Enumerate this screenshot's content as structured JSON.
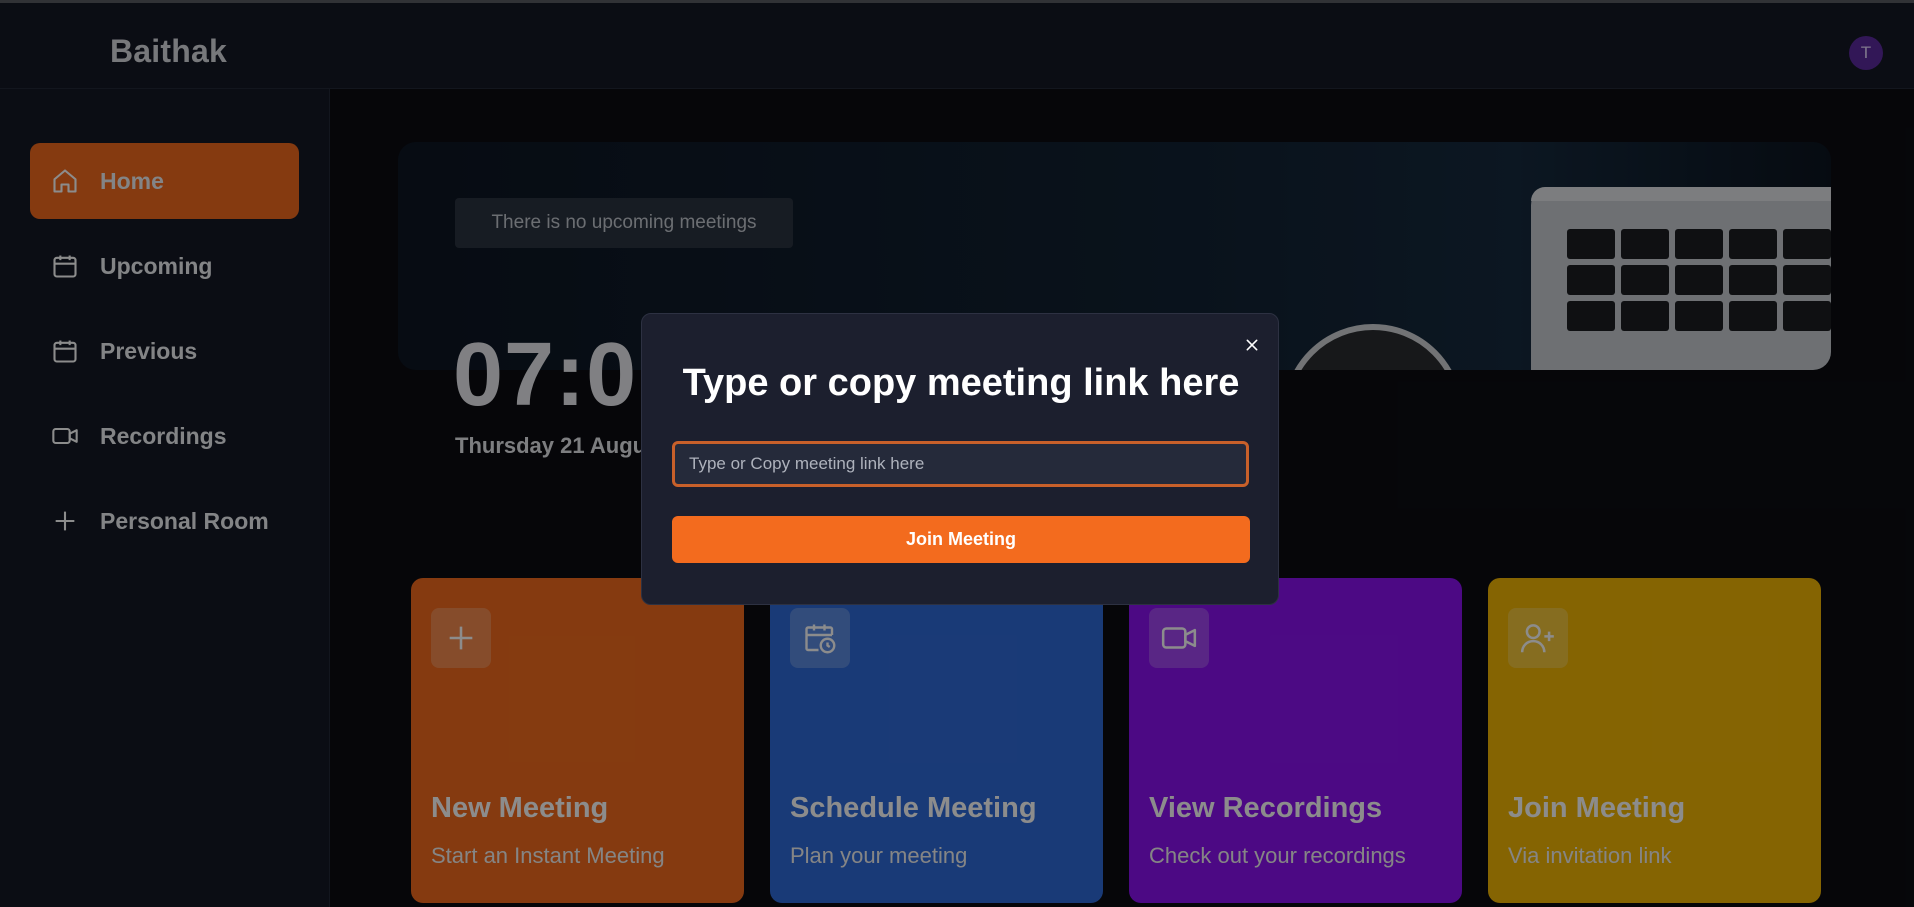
{
  "app": {
    "brand": "Baithak",
    "avatar_initial": "T"
  },
  "sidebar": {
    "items": [
      {
        "label": "Home",
        "icon": "home-icon",
        "active": true
      },
      {
        "label": "Upcoming",
        "icon": "calendar-icon",
        "active": false
      },
      {
        "label": "Previous",
        "icon": "calendar-icon",
        "active": false
      },
      {
        "label": "Recordings",
        "icon": "video-icon",
        "active": false
      },
      {
        "label": "Personal Room",
        "icon": "plus-icon",
        "active": false
      }
    ]
  },
  "hero": {
    "upcoming_text": "There is no upcoming meetings",
    "time": "07:0",
    "date": "Thursday 21 Augus"
  },
  "cards": [
    {
      "title": "New Meeting",
      "subtitle": "Start an Instant Meeting",
      "icon": "plus-icon",
      "color": "#f36b1e"
    },
    {
      "title": "Schedule Meeting",
      "subtitle": "Plan your meeting",
      "icon": "calendar-clock-icon",
      "color": "#2f6ad9"
    },
    {
      "title": "View Recordings",
      "subtitle": "Check out your recordings",
      "icon": "video-icon",
      "color": "#8a12f0"
    },
    {
      "title": "Join Meeting",
      "subtitle": "Via invitation link",
      "icon": "user-plus-icon",
      "color": "#f2b705"
    }
  ],
  "modal": {
    "title": "Type or copy meeting link here",
    "input_placeholder": "Type or Copy meeting link here",
    "input_value": "",
    "button_label": "Join Meeting"
  },
  "colors": {
    "accent": "#f36b1e",
    "background": "#0b0c12",
    "panel": "#141825"
  }
}
